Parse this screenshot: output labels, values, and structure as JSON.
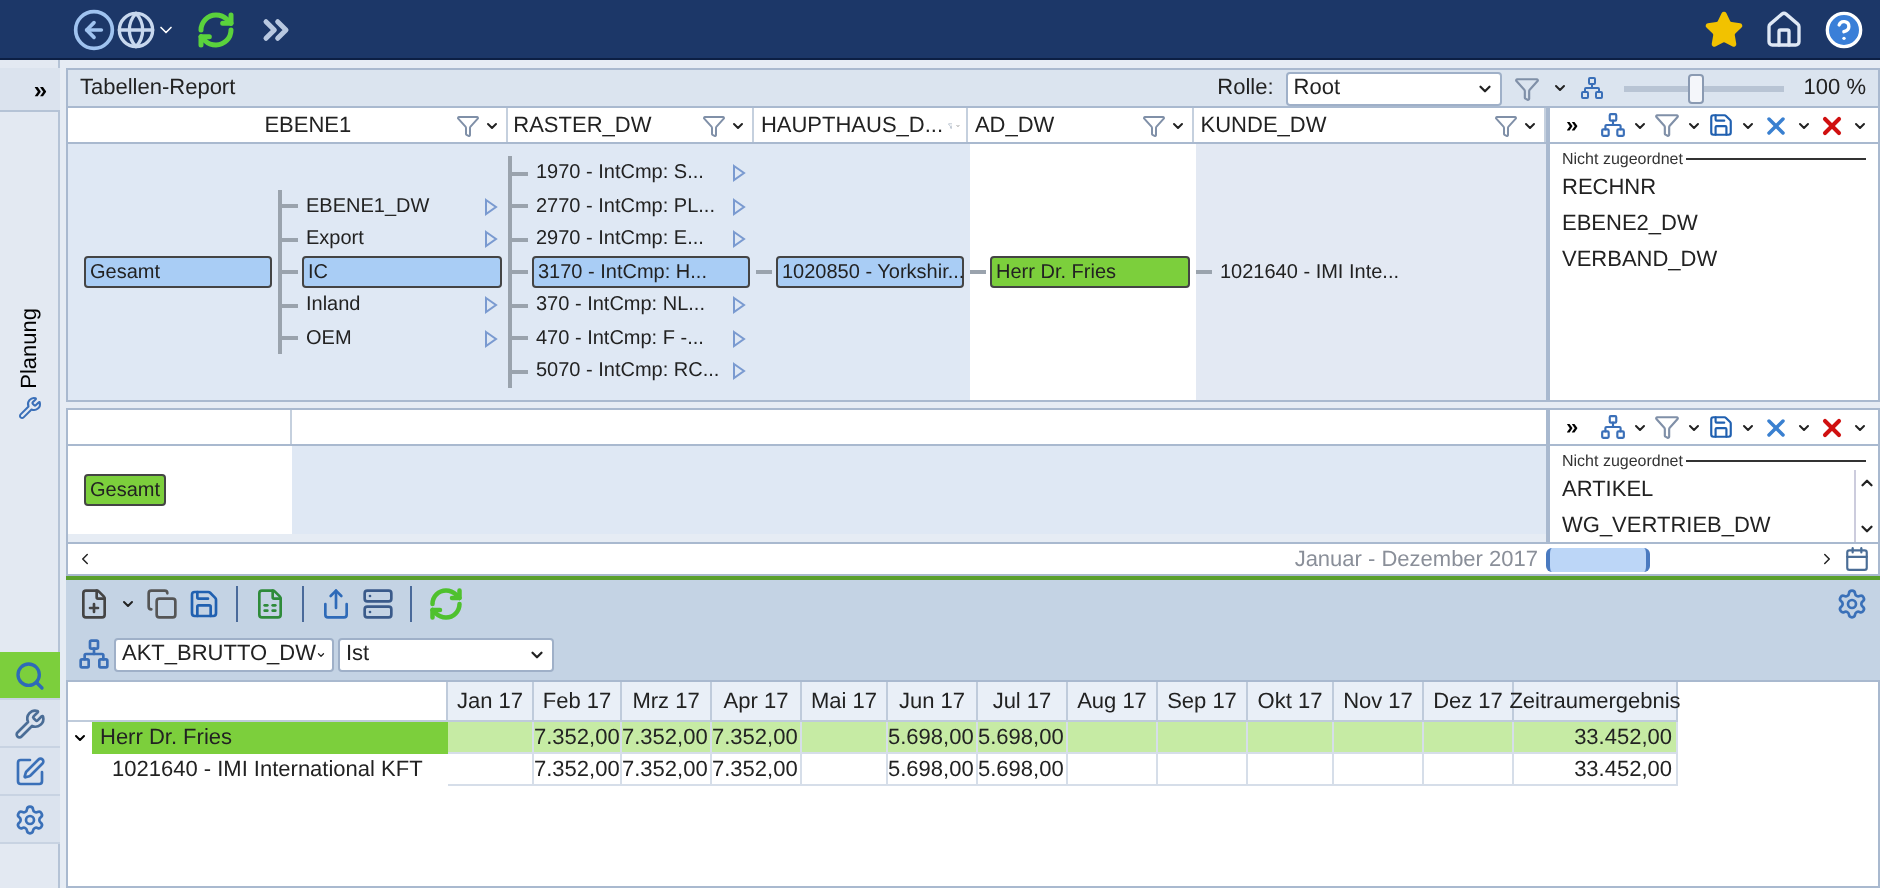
{
  "report": {
    "title": "Tabellen-Report",
    "role_label": "Rolle:",
    "role_value": "Root",
    "zoom": "100 %",
    "level": 0.45
  },
  "sidebar": {
    "collapse": "»",
    "label": "Planung",
    "tools": [
      {
        "kind": "analysis",
        "selected": true
      },
      {
        "kind": "tools",
        "selected": false
      },
      {
        "kind": "edit",
        "selected": false
      },
      {
        "kind": "settings",
        "selected": false
      }
    ]
  },
  "pivot_top": {
    "columns": [
      {
        "label": "EBENE1"
      },
      {
        "label": "RASTER_DW"
      },
      {
        "label": "HAUPTHAUS_D..."
      },
      {
        "label": "AD_DW"
      },
      {
        "label": "KUNDE_DW"
      }
    ],
    "tree": {
      "label": "Gesamt",
      "selected": true,
      "color": "#a9cdf5",
      "children": [
        {
          "label": "EBENE1_DW",
          "selected": false,
          "expandable": true
        },
        {
          "label": "Export",
          "selected": false,
          "expandable": true
        },
        {
          "label": "IC",
          "selected": true,
          "color": "#a9cdf5",
          "children": [
            {
              "label": "1970 - IntCmp: S...",
              "selected": false,
              "expandable": true
            },
            {
              "label": "2770 - IntCmp: PL...",
              "selected": false,
              "expandable": true
            },
            {
              "label": "2970 - IntCmp: E...",
              "selected": false,
              "expandable": true
            },
            {
              "label": "3170 - IntCmp: H...",
              "selected": true,
              "color": "#a9cdf5",
              "children": [
                {
                  "label": "1020850 - Yorkshir...",
                  "selected": true,
                  "color": "#a9cdf5",
                  "children": [
                    {
                      "label": "Herr Dr. Fries",
                      "selected": true,
                      "color": "#7ccf3c",
                      "children": [
                        {
                          "label": "1021640 - IMI Inte...",
                          "selected": false,
                          "expandable": false
                        }
                      ]
                    }
                  ]
                }
              ]
            },
            {
              "label": "370 - IntCmp: NL...",
              "selected": false,
              "expandable": true
            },
            {
              "label": "470 - IntCmp: F -...",
              "selected": false,
              "expandable": true
            },
            {
              "label": "5070 - IntCmp: RC...",
              "selected": false,
              "expandable": true
            }
          ]
        },
        {
          "label": "Inland",
          "selected": false,
          "expandable": true
        },
        {
          "label": "OEM",
          "selected": false,
          "expandable": true
        }
      ]
    },
    "panel": {
      "collapse": "»",
      "heading": "Nicht zugeordnet",
      "items": [
        "RECHNR",
        "EBENE2_DW",
        "VERBAND_DW"
      ]
    }
  },
  "pivot_bottom": {
    "tree": {
      "label": "Gesamt",
      "selected": true,
      "color": "#7ccf3c"
    },
    "panel": {
      "collapse": "»",
      "heading": "Nicht zugeordnet",
      "items": [
        "ARTIKEL",
        "WG_VERTRIEB_DW"
      ]
    }
  },
  "timeline": {
    "label": "Januar - Dezember 2017"
  },
  "selector": {
    "measure": "AKT_BRUTTO_DW",
    "version": "Ist"
  },
  "table": {
    "columns": [
      "Jan 17",
      "Feb 17",
      "Mrz 17",
      "Apr 17",
      "Mai 17",
      "Jun 17",
      "Jul 17",
      "Aug 17",
      "Sep 17",
      "Okt 17",
      "Nov 17",
      "Dez 17",
      "Zeitraumergebnis"
    ],
    "rows": [
      {
        "label": "Herr Dr. Fries",
        "selected": true,
        "expanded": true,
        "cells": [
          null,
          "7.352,00",
          "7.352,00",
          "7.352,00",
          null,
          "5.698,00",
          "5.698,00",
          null,
          null,
          null,
          null,
          null,
          "33.452,00"
        ],
        "children": [
          {
            "label": "1021640 - IMI International KFT",
            "selected": false,
            "cells": [
              null,
              "7.352,00",
              "7.352,00",
              "7.352,00",
              null,
              "5.698,00",
              "5.698,00",
              null,
              null,
              null,
              null,
              null,
              "33.452,00"
            ]
          }
        ]
      }
    ]
  }
}
